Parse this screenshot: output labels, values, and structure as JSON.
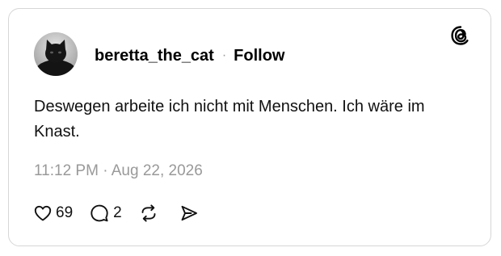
{
  "post": {
    "username": "beretta_the_cat",
    "separator": "·",
    "follow_label": "Follow",
    "text": "Deswegen arbeite ich nicht mit Menschen. Ich wäre im Knast.",
    "timestamp": "11:12 PM · Aug 22, 2026",
    "likes": "69",
    "replies": "2"
  },
  "icons": {
    "brand": "threads-logo-icon",
    "like": "heart-icon",
    "reply": "comment-bubble-icon",
    "repost": "repost-arrows-icon",
    "share": "send-icon"
  },
  "colors": {
    "text": "#111111",
    "muted": "#999999",
    "border": "#d6d6d6"
  }
}
